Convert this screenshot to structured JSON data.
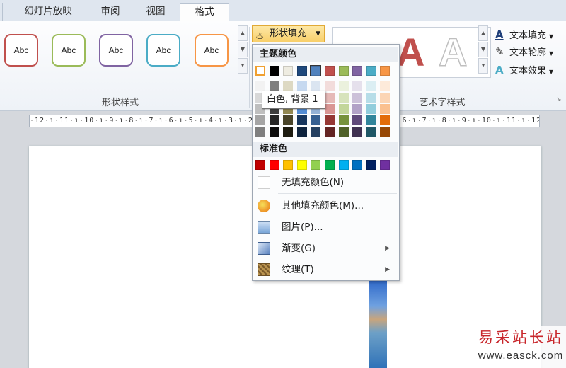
{
  "tabs": [
    {
      "label": "幻灯片放映",
      "active": false
    },
    {
      "label": "审阅",
      "active": false
    },
    {
      "label": "视图",
      "active": false
    },
    {
      "label": "格式",
      "active": true
    }
  ],
  "shape_styles": {
    "group_label": "形状样式",
    "thumbs": [
      {
        "label": "Abc",
        "color": "#c0504d"
      },
      {
        "label": "Abc",
        "color": "#9bbb59"
      },
      {
        "label": "Abc",
        "color": "#8064a2"
      },
      {
        "label": "Abc",
        "color": "#4bacc6"
      },
      {
        "label": "Abc",
        "color": "#f79646"
      }
    ]
  },
  "shape_fill_button": {
    "label": "形状填充"
  },
  "wordart": {
    "group_label": "艺术字样式",
    "buttons": [
      {
        "label": "文本填充",
        "icon": "text-fill-icon",
        "glyph": "A"
      },
      {
        "label": "文本轮廓",
        "icon": "text-outline-icon",
        "glyph": "✎"
      },
      {
        "label": "文本效果",
        "icon": "text-effects-icon",
        "glyph": "A"
      }
    ]
  },
  "ruler": {
    "text": "·12·ı·11·ı·10·ı·9·ı·8·ı·7·ı·6·ı·5·ı·4·ı·3·ı·2·ı·1·ı··ı·1·ı·2·ı·3·ı·4·ı·5·ı·6·ı·7·ı·8·ı·9·ı·10·ı·11·ı·12·"
  },
  "dropdown": {
    "theme_colors_label": "主题颜色",
    "theme_colors": [
      "#ffffff",
      "#000000",
      "#eeece1",
      "#1f497d",
      "#4f81bd",
      "#c0504d",
      "#9bbb59",
      "#8064a2",
      "#4bacc6",
      "#f79646"
    ],
    "theme_shades": [
      [
        "#f2f2f2",
        "#d8d8d8",
        "#bfbfbf",
        "#a5a5a5",
        "#7f7f7f"
      ],
      [
        "#7f7f7f",
        "#595959",
        "#3f3f3f",
        "#262626",
        "#0c0c0c"
      ],
      [
        "#ddd9c3",
        "#c4bd97",
        "#938953",
        "#494429",
        "#1d1b10"
      ],
      [
        "#c6d9f0",
        "#8db3e2",
        "#548dd4",
        "#17365d",
        "#0f243e"
      ],
      [
        "#dbe5f1",
        "#b8cce4",
        "#95b3d7",
        "#366092",
        "#244061"
      ],
      [
        "#f2dcdb",
        "#e5b9b7",
        "#d99694",
        "#953734",
        "#632423"
      ],
      [
        "#ebf1dd",
        "#d7e3bc",
        "#c3d69b",
        "#76923c",
        "#4f6128"
      ],
      [
        "#e5e0ec",
        "#ccc1d9",
        "#b2a2c7",
        "#5f497a",
        "#3f3151"
      ],
      [
        "#dbeef3",
        "#b7dde8",
        "#92cddc",
        "#31859b",
        "#205867"
      ],
      [
        "#fdeada",
        "#fbd5b5",
        "#fac08f",
        "#e36c09",
        "#974806"
      ]
    ],
    "standard_colors_label": "标准色",
    "standard_colors": [
      "#c00000",
      "#ff0000",
      "#ffc000",
      "#ffff00",
      "#92d050",
      "#00b050",
      "#00b0f0",
      "#0070c0",
      "#002060",
      "#7030a0"
    ],
    "no_fill_label": "无填充颜色(N)",
    "items": [
      {
        "label": "其他填充颜色(M)...",
        "icon": "palette-icon",
        "submenu": false
      },
      {
        "label": "图片(P)...",
        "icon": "picture-icon",
        "submenu": false
      },
      {
        "label": "渐变(G)",
        "icon": "gradient-icon",
        "submenu": true
      },
      {
        "label": "纹理(T)",
        "icon": "texture-icon",
        "submenu": true
      }
    ],
    "submenu_glyph": "▶"
  },
  "tooltip": {
    "text": "白色, 背景 1"
  },
  "watermark": {
    "line1": "易采站长站",
    "line2": "www.easck.com"
  }
}
